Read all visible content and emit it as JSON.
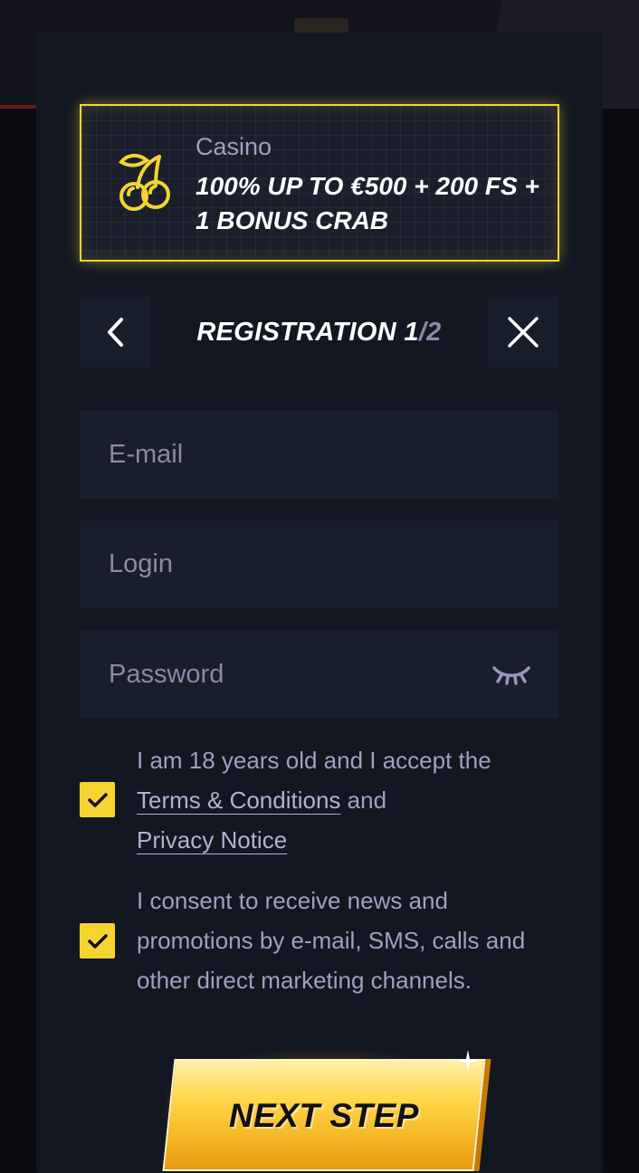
{
  "promo": {
    "category": "Casino",
    "offer": "100% UP TO €500 + 200 FS + 1 BONUS CRAB",
    "icon": "cherry-icon",
    "accent_color": "#f5d431"
  },
  "header": {
    "title_main": "REGISTRATION 1",
    "title_separator": "/",
    "title_total": "2",
    "back_icon": "chevron-left-icon",
    "close_icon": "close-icon"
  },
  "form": {
    "email_placeholder": "E-mail",
    "email_value": "",
    "login_placeholder": "Login",
    "login_value": "",
    "password_placeholder": "Password",
    "password_value": "",
    "password_toggle_icon": "eye-closed-icon"
  },
  "consents": {
    "terms_prefix": "I am 18 years old and I accept the",
    "terms_link": "Terms & Conditions",
    "terms_and": "and",
    "privacy_link": "Privacy Notice",
    "terms_checked": true,
    "marketing_text": "I consent to receive news and promotions by e-mail, SMS, calls and other direct marketing channels.",
    "marketing_checked": true
  },
  "actions": {
    "next_label": "NEXT STEP"
  }
}
